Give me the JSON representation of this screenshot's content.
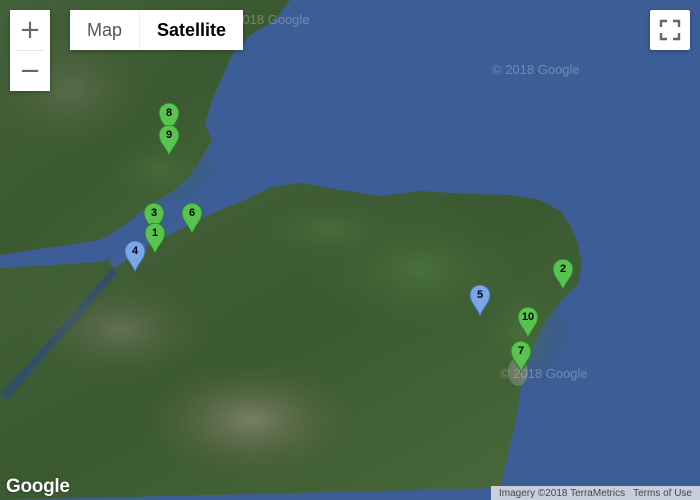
{
  "controls": {
    "zoom_in": "+",
    "zoom_out": "−",
    "map_type_map": "Map",
    "map_type_satellite": "Satellite"
  },
  "watermarks": [
    "© 2018 Google",
    "© 2018 Google",
    "© 2018 Google"
  ],
  "markers": [
    {
      "label": "8",
      "color": "#5ac34f"
    },
    {
      "label": "9",
      "color": "#5ac34f"
    },
    {
      "label": "3",
      "color": "#5ac34f"
    },
    {
      "label": "6",
      "color": "#5ac34f"
    },
    {
      "label": "1",
      "color": "#5ac34f"
    },
    {
      "label": "4",
      "color": "#7ba7e8"
    },
    {
      "label": "2",
      "color": "#5ac34f"
    },
    {
      "label": "5",
      "color": "#7ba7e8"
    },
    {
      "label": "10",
      "color": "#5ac34f"
    },
    {
      "label": "7",
      "color": "#5ac34f"
    }
  ],
  "logo": "Google",
  "attribution": {
    "imagery": "Imagery ©2018 TerraMetrics",
    "terms": "Terms of Use"
  },
  "colors": {
    "sea": "#3e5f97",
    "land": "#3b5a32",
    "marker_green": "#5ac34f",
    "marker_blue": "#7ba7e8"
  }
}
